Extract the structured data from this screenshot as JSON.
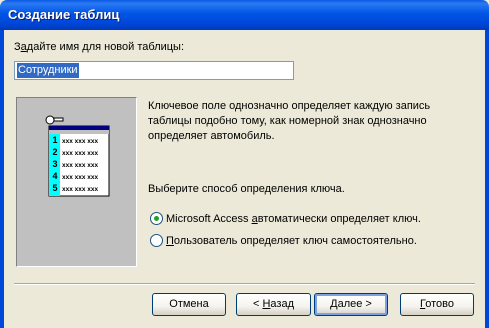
{
  "window": {
    "title": "Создание таблиц"
  },
  "form": {
    "prompt_prefix": "З",
    "prompt_accel": "а",
    "prompt_rest": "дайте имя для новой таблицы:",
    "table_name_value": "Сотрудники"
  },
  "preview": {
    "row_numbers": [
      "1",
      "2",
      "3",
      "4",
      "5"
    ],
    "cell_text": "xxx xxx xxx"
  },
  "description": {
    "text": "Ключевое поле однозначно определяет каждую запись таблицы подобно тому, как номерной знак однозначно определяет автомобиль.",
    "choose_prompt": "Выберите способ определения ключа."
  },
  "options": [
    {
      "prefix": "Microsoft Access ",
      "accel": "а",
      "rest": "втоматически определяет ключ.",
      "checked": true
    },
    {
      "prefix": "",
      "accel": "П",
      "rest": "ользователь определяет ключ самостоятельно.",
      "checked": false
    }
  ],
  "buttons": {
    "cancel": "Отмена",
    "back_prefix": "< ",
    "back_accel": "Н",
    "back_rest": "азад",
    "next_prefix": "",
    "next_accel": "Д",
    "next_rest": "алее >",
    "finish_accel": "Г",
    "finish_rest": "отово"
  },
  "colors": {
    "titlebar": "#0055E5",
    "dialog_bg": "#ECE9D8",
    "selection": "#316AC5",
    "preview_bg": "#C0C0C0",
    "grid_header": "#000080",
    "row_number_bg": "#00FFFF",
    "radio_dot": "#21A121"
  }
}
